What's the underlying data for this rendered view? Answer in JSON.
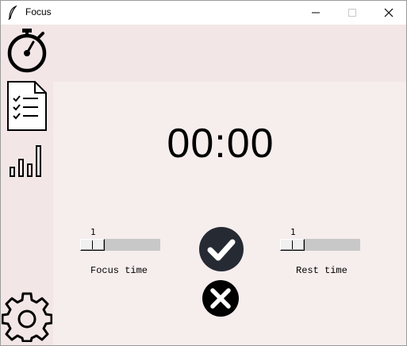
{
  "window": {
    "title": "Focus"
  },
  "titlebar": {
    "icons": [
      "feather-icon",
      "minimize-icon",
      "maximize-icon",
      "close-icon"
    ]
  },
  "sidebar": {
    "items": [
      {
        "icon": "stopwatch-icon"
      },
      {
        "icon": "checklist-icon"
      },
      {
        "icon": "bar-chart-icon"
      },
      {
        "icon": "gear-icon"
      }
    ]
  },
  "timer": {
    "display": "00:00"
  },
  "focus_slider": {
    "value": "1",
    "label": "Focus time"
  },
  "rest_slider": {
    "value": "1",
    "label": "Rest time"
  },
  "actions": {
    "confirm_icon": "checkmark-icon",
    "cancel_icon": "x-icon"
  },
  "colors": {
    "sidebar_bg": "#f3e6e6",
    "main_bg": "#f6eded",
    "button_bg": "#262a33",
    "slider_track": "#c8c8c8"
  }
}
